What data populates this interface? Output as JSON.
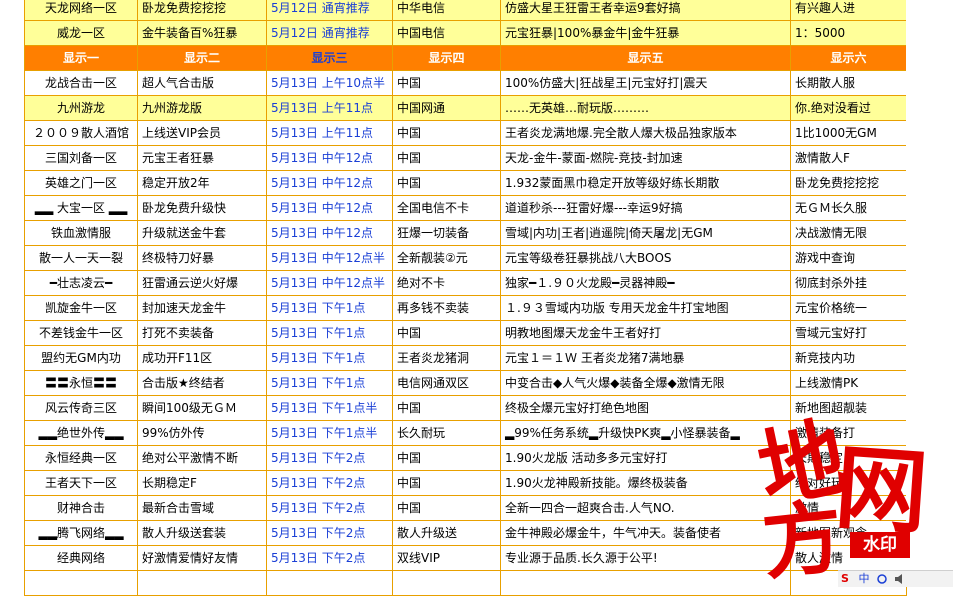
{
  "table": {
    "top_rows": [
      {
        "cells": [
          "天龙网络一区",
          "卧龙免费挖挖挖",
          "5月12日 通宵推荐",
          "中华电信",
          "仿盛大星王狂雷王者幸运9套好搞",
          "有兴趣人进"
        ]
      },
      {
        "cells": [
          "威龙一区",
          "金牛装备百%狂暴",
          "5月12日 通宵推荐",
          "中国电信",
          "元宝狂暴|100%暴金牛|金牛狂暴",
          "1：5000"
        ]
      }
    ],
    "headers": [
      "显示一",
      "显示二",
      "显示三",
      "显示四",
      "显示五",
      "显示六"
    ],
    "rows": [
      {
        "cells": [
          "龙战合击一区",
          "超人气合击版",
          "5月13日 上午10点半",
          "中国",
          "100%仿盛大|狂战星王|元宝好打|震天",
          "长期散人服"
        ]
      },
      {
        "cells": [
          "九州游龙",
          "九州游龙版",
          "5月13日 上午11点",
          "中国网通",
          "……无英雄…耐玩版………",
          "你.绝对没看过"
        ]
      },
      {
        "cells": [
          "２００９散人酒馆",
          "上线送VIP会员",
          "5月13日 上午11点",
          "中国",
          "王者炎龙满地爆.完全散人爆大极品独家版本",
          "1比1000无GM"
        ]
      },
      {
        "cells": [
          "三国刘备一区",
          "元宝王者狂暴",
          "5月13日 中午12点",
          "中国",
          "天龙-金牛-蒙面-燃院-竞技-封加速",
          "激情散人F"
        ]
      },
      {
        "cells": [
          "英雄之门一区",
          "稳定开放2年",
          "5月13日 中午12点",
          "中国",
          "1.932蒙面黑巾稳定开放等级好练长期散",
          "卧龙免费挖挖挖"
        ]
      },
      {
        "cells": [
          "▂▂ 大宝一区 ▂▂",
          "卧龙免费升级快",
          "5月13日 中午12点",
          "全国电信不卡",
          "道道秒杀---狂雷好爆---幸运9好搞",
          "无ＧＭ长久服"
        ]
      },
      {
        "cells": [
          "铁血激情服",
          "升级就送金牛套",
          "5月13日 中午12点",
          "狂爆一切装备",
          "雪域|内功|王者|逍遥院|倚天屠龙|无GM",
          "决战激情无限"
        ]
      },
      {
        "cells": [
          "散一人一天一裂",
          "终极特刀好暴",
          "5月13日 中午12点半",
          "全新靓装②元",
          "元宝等级卷狂暴挑战八大BOOS",
          "游戏中查询"
        ]
      },
      {
        "cells": [
          "━壮志凌云━",
          "狂雷通云逆火好爆",
          "5月13日 中午12点半",
          "绝对不卡",
          "独家━１.９０火龙殿━灵器神殿━",
          "彻底封杀外挂"
        ]
      },
      {
        "cells": [
          "凯旋金牛一区",
          "封加速天龙金牛",
          "5月13日 下午1点",
          "再多钱不卖装",
          "１.９３雪域内功版 专用天龙金牛打宝地图",
          "元宝价格统一"
        ]
      },
      {
        "cells": [
          "不差钱金牛一区",
          "打死不卖装备",
          "5月13日 下午1点",
          "中国",
          "明教地图爆天龙金牛王者好打",
          "雪域元宝好打"
        ]
      },
      {
        "cells": [
          "盟约无GM内功",
          "成功开F11区",
          "5月13日 下午1点",
          "王者炎龙猪洞",
          "元宝１＝１Ｗ 王者炎龙猪7满地暴",
          "新竞技内功"
        ]
      },
      {
        "cells": [
          "〓〓永恒〓〓",
          "合击版★终结者",
          "5月13日 下午1点",
          "电信网通双区",
          "中变合击◆人气火爆◆装备全爆◆激情无限",
          "上线激情PK"
        ]
      },
      {
        "cells": [
          "风云传奇三区",
          "瞬间100级无ＧＭ",
          "5月13日 下午1点半",
          "中国",
          "终极全爆元宝好打绝色地图",
          "新地图超靓装"
        ]
      },
      {
        "cells": [
          "▂▂绝世外传▂▂",
          "99%仿外传",
          "5月13日 下午1点半",
          "长久耐玩",
          "▂99%任务系统▂升级快PK爽▂小怪暴装备▂",
          "激情装备打"
        ]
      },
      {
        "cells": [
          "永恒经典一区",
          "绝对公平激情不断",
          "5月13日 下午2点",
          "中国",
          "1.90火龙版 活动多多元宝好打",
          "长期稳定"
        ]
      },
      {
        "cells": [
          "王者天下一区",
          "长期稳定F",
          "5月13日 下午2点",
          "中国",
          "1.90火龙神殿新技能。爆终极装备",
          "绝对好玩"
        ]
      },
      {
        "cells": [
          "财神合击",
          "最新合击雪域",
          "5月13日 下午2点",
          "中国",
          "全新一四合一超爽合击.人气NO.",
          "激情"
        ]
      },
      {
        "cells": [
          "▂▂腾飞网络▂▂",
          "散人升级送套装",
          "5月13日 下午2点",
          "散人升级送",
          "金牛神殿必爆金牛，牛气冲天。装备使者",
          "新地图新观念"
        ]
      },
      {
        "cells": [
          "经典网络",
          "好激情爱情好友情",
          "5月13日 下午2点",
          "双线VIP",
          "专业源于品质.长久源于公平!",
          "散人激情"
        ]
      },
      {
        "cells": [
          "",
          "",
          "",
          "",
          "",
          ""
        ]
      }
    ]
  },
  "watermark": {
    "chars": [
      "地",
      "网",
      "方"
    ],
    "badge": "水印",
    "color": "#e00000"
  },
  "tray": {
    "logo": "S",
    "cn": "中",
    "icons": [
      "ime-icon",
      "speaker-icon"
    ]
  },
  "colors": {
    "header_bg": "#ff7f00",
    "border": "#e8a000",
    "highlight_bg": "#ffff99",
    "time_text": "#1a3fd6"
  }
}
